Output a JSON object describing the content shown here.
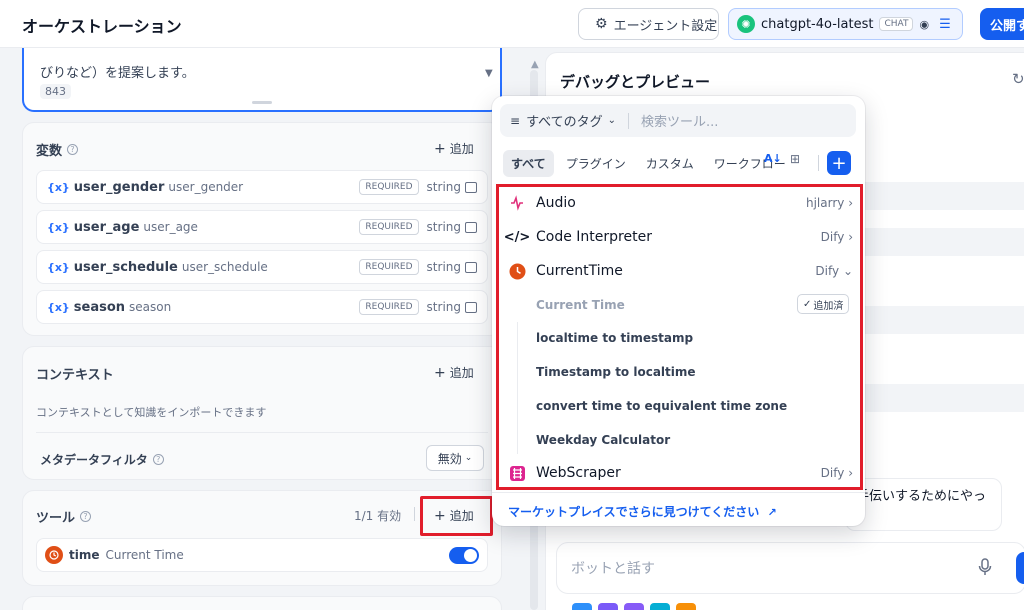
{
  "header": {
    "title": "オーケストレーション",
    "agent_settings_label": "エージェント設定",
    "model_name": "chatgpt-4o-latest",
    "model_badge": "CHAT",
    "publish_label": "公開す"
  },
  "prompt": {
    "text": "びりなど）を提案します。",
    "count": "843"
  },
  "variables": {
    "title": "変数",
    "add_label": "追加",
    "items": [
      {
        "name": "user_gender",
        "sub": "user_gender",
        "required": "REQUIRED",
        "type": "string"
      },
      {
        "name": "user_age",
        "sub": "user_age",
        "required": "REQUIRED",
        "type": "string"
      },
      {
        "name": "user_schedule",
        "sub": "user_schedule",
        "required": "REQUIRED",
        "type": "string"
      },
      {
        "name": "season",
        "sub": "season",
        "required": "REQUIRED",
        "type": "string"
      }
    ]
  },
  "context": {
    "title": "コンテキスト",
    "add_label": "追加",
    "description": "コンテキストとして知識をインポートできます",
    "metadata_filter_label": "メタデータフィルタ",
    "metadata_filter_value": "無効"
  },
  "tools": {
    "title": "ツール",
    "count_label": "1/1 有効",
    "add_label": "追加",
    "items": [
      {
        "name": "time",
        "sub": "Current Time",
        "enabled": true
      }
    ]
  },
  "preview": {
    "title": "デバッグとプレビュー",
    "bot_message": "手伝いするためにやっ",
    "input_placeholder": "ボットと話す"
  },
  "tool_picker": {
    "tag_filter_label": "すべてのタグ",
    "search_placeholder": "検索ツール...",
    "tabs": [
      "すべて",
      "プラグイン",
      "カスタム",
      "ワークフロー"
    ],
    "active_tab": "すべて",
    "providers": [
      {
        "name": "Audio",
        "source": "hjlarry",
        "icon": "audio-icon"
      },
      {
        "name": "Code Interpreter",
        "source": "Dify",
        "icon": "code-icon"
      },
      {
        "name": "CurrentTime",
        "source": "Dify",
        "icon": "clock-icon"
      },
      {
        "name": "WebScraper",
        "source": "Dify",
        "icon": "web-scraper-icon"
      }
    ],
    "current_time_tools": {
      "header": "Current Time",
      "added_label": "追加済",
      "items": [
        "localtime to timestamp",
        "Timestamp to localtime",
        "convert time to equivalent time zone",
        "Weekday Calculator"
      ]
    },
    "marketplace_link": "マーケットプレイスでさらに見つけてください"
  },
  "colors": {
    "accent": "#155eef",
    "highlight": "#e11d2b",
    "clock": "#e04f16",
    "audio": "#e0317b",
    "webscraper": "#dd2590"
  }
}
